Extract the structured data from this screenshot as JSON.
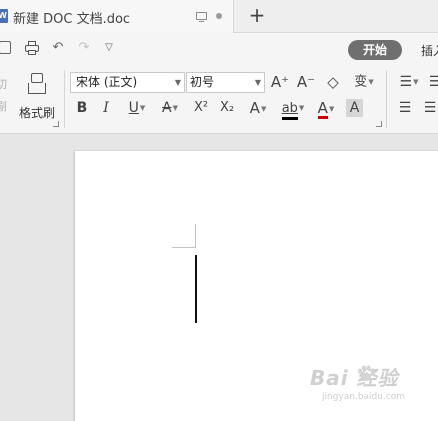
{
  "tab": {
    "icon_glyph": "W",
    "title": "新建 DOC 文档.doc",
    "new_tab": "+"
  },
  "quick_access": {
    "undo": "↶",
    "redo": "↷",
    "customize": "▽"
  },
  "menu_tabs": {
    "home": "开始",
    "insert": "插入"
  },
  "ribbon": {
    "cut_partial_top": "切",
    "cut_partial_bottom": "剐",
    "format_painter": "格式刷",
    "font_name": "宋体 (正文)",
    "font_size": "初号",
    "grow_font": "A⁺",
    "shrink_font": "A⁻",
    "clear_format": "◇",
    "phonetic": "变",
    "bold": "B",
    "italic": "I",
    "underline": "U",
    "strikethrough": "A",
    "superscript": "X²",
    "subscript": "X₂",
    "text_effect": "A",
    "highlight": "ab",
    "font_color": "A",
    "char_shading": "A",
    "bullets": "☰",
    "align_left": "☰",
    "align_center": "☰",
    "colors": {
      "highlight": "#000000",
      "font_color": "#cc0000"
    }
  },
  "watermark": {
    "main": "Bai 经验",
    "sub": "jingyan.baidu.com"
  }
}
